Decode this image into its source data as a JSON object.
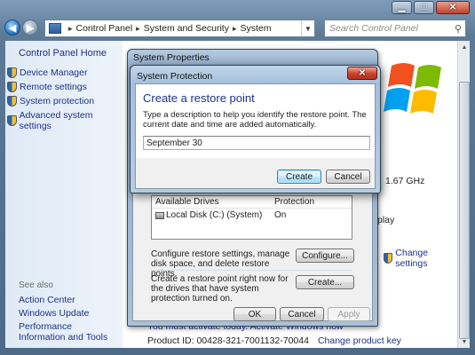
{
  "window": {
    "title_buttons": {
      "minimize": "▁",
      "maximize": "□",
      "close": "✕"
    },
    "nav": {
      "back_icon": "back-arrow",
      "forward_icon": "forward-arrow"
    },
    "breadcrumb": [
      "Control Panel",
      "System and Security",
      "System"
    ],
    "search_placeholder": "Search Control Panel"
  },
  "left_pane": {
    "home": "Control Panel Home",
    "items": [
      "Device Manager",
      "Remote settings",
      "System protection",
      "Advanced system settings"
    ],
    "see_also_label": "See also",
    "see_also": [
      "Action Center",
      "Windows Update",
      "Performance Information and Tools"
    ]
  },
  "content": {
    "cpu_speed": "1.67 GHz",
    "display_fragment": "play",
    "change_settings": "Change settings",
    "activate_text": "You must activate today. Activate Windows now",
    "product_id": "Product ID: 00428-321-7001132-70044",
    "change_product_key": "Change product key"
  },
  "system_properties": {
    "title": "System Properties",
    "drives_header": {
      "drive": "Available Drives",
      "protection": "Protection"
    },
    "drives": [
      {
        "name": "Local Disk (C:) (System)",
        "protection": "On"
      }
    ],
    "configure_text": "Configure restore settings, manage disk space, and delete restore points.",
    "configure_button": "Configure...",
    "create_text": "Create a restore point right now for the drives that have system protection turned on.",
    "create_button": "Create...",
    "ok_button": "OK",
    "cancel_button": "Cancel",
    "apply_button": "Apply"
  },
  "system_protection": {
    "title": "System Protection",
    "close_glyph": "✕",
    "heading": "Create a restore point",
    "description": "Type a description to help you identify the restore point. The current date and time are added automatically.",
    "input_value": "September 30",
    "create_button": "Create",
    "cancel_button": "Cancel"
  }
}
